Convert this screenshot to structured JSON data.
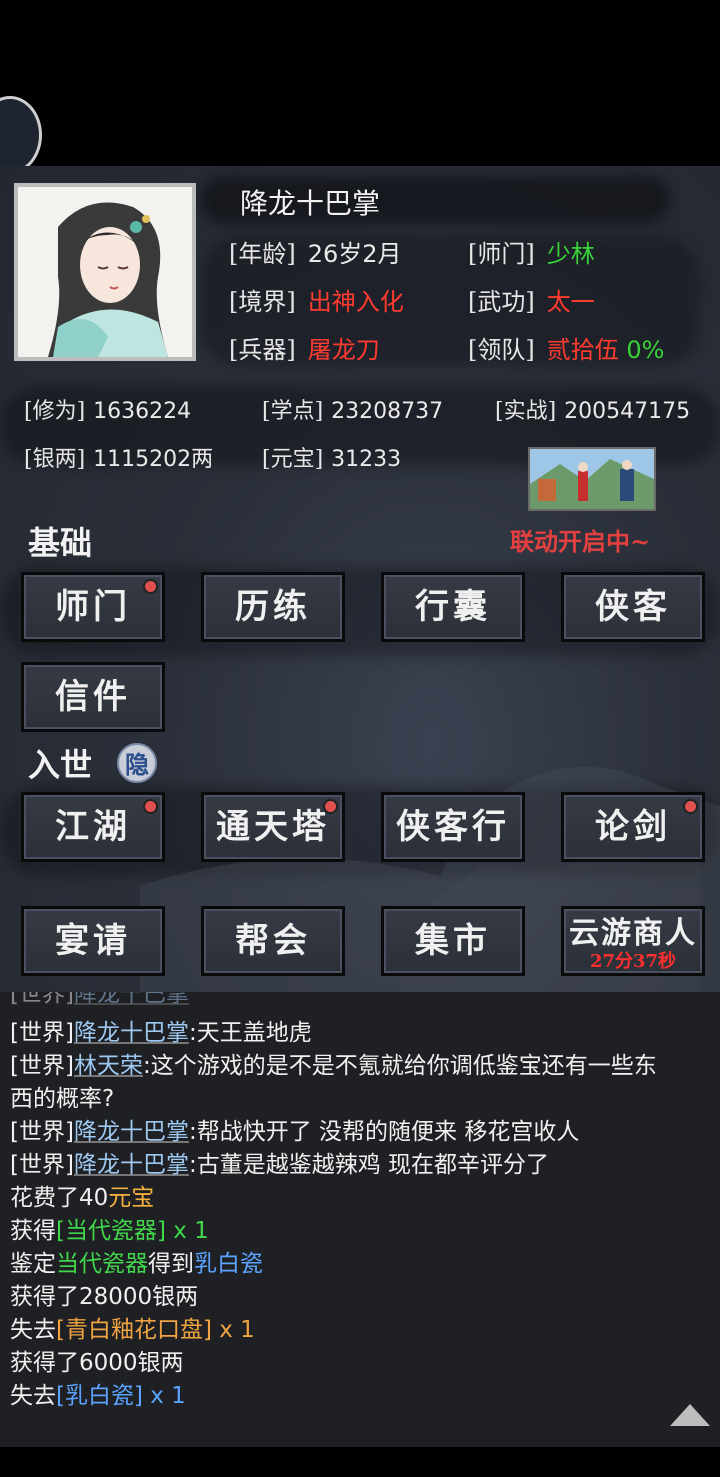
{
  "profile": {
    "name": "降龙十巴掌",
    "age_label": "[年龄]",
    "age": "26岁2月",
    "sect_label": "[师门]",
    "sect": "少林",
    "realm_label": "[境界]",
    "realm": "出神入化",
    "martial_label": "[武功]",
    "martial": "太一",
    "weapon_label": "[兵器]",
    "weapon": "屠龙刀",
    "team_label": "[领队]",
    "team": "贰拾伍",
    "team_pct": "0%"
  },
  "resources": {
    "cultivation_label": "[修为]",
    "cultivation": "1636224",
    "study_label": "[学点]",
    "study": "23208737",
    "combat_label": "[实战]",
    "combat": "200547175",
    "silver_label": "[银两]",
    "silver": "1115202两",
    "ingot_label": "[元宝]",
    "ingot": "31233"
  },
  "event": {
    "text": "联动开启中~"
  },
  "basic": {
    "title": "基础",
    "buttons": [
      "师门",
      "历练",
      "行囊",
      "侠客",
      "信件"
    ]
  },
  "world": {
    "title": "入世",
    "badge": "隐",
    "buttons": [
      "江湖",
      "通天塔",
      "侠客行",
      "论剑",
      "宴请",
      "帮会",
      "集市",
      "云游商人"
    ],
    "merchant_timer": "27分37秒"
  },
  "log": {
    "lines": [
      {
        "channel": "[世界]",
        "sender": "降龙十巴掌",
        "text": ":天王盖地虎"
      },
      {
        "channel": "[世界]",
        "sender": "林天荣",
        "text": ":这个游戏的是不是不氪就给你调低鉴宝还有一些东"
      },
      {
        "text": "西的概率?"
      },
      {
        "channel": "[世界]",
        "sender": "降龙十巴掌",
        "text": ":帮战快开了  没帮的随便来  移花宫收人"
      },
      {
        "channel": "[世界]",
        "sender": "降龙十巴掌",
        "text": ":古董是越鉴越辣鸡  现在都辛评分了"
      },
      {
        "pre": "花费了40",
        "item": "元宝"
      },
      {
        "pre": "获得",
        "item": "[当代瓷器]",
        "post": " x 1"
      },
      {
        "pre": "鉴定",
        "item": "当代瓷器",
        "mid": "得到",
        "item2": "乳白瓷"
      },
      {
        "text": "获得了28000银两"
      },
      {
        "pre": "失去",
        "item": "[青白釉花口盘]",
        "post": " x 1"
      },
      {
        "text": "获得了6000银两"
      },
      {
        "pre": "失去",
        "item": "[乳白瓷]",
        "post": " x 1"
      }
    ]
  },
  "colors": {
    "green": "#39d13a",
    "red": "#ff3b30",
    "link_blue": "#5ba3ff",
    "orange": "#f0a442"
  }
}
